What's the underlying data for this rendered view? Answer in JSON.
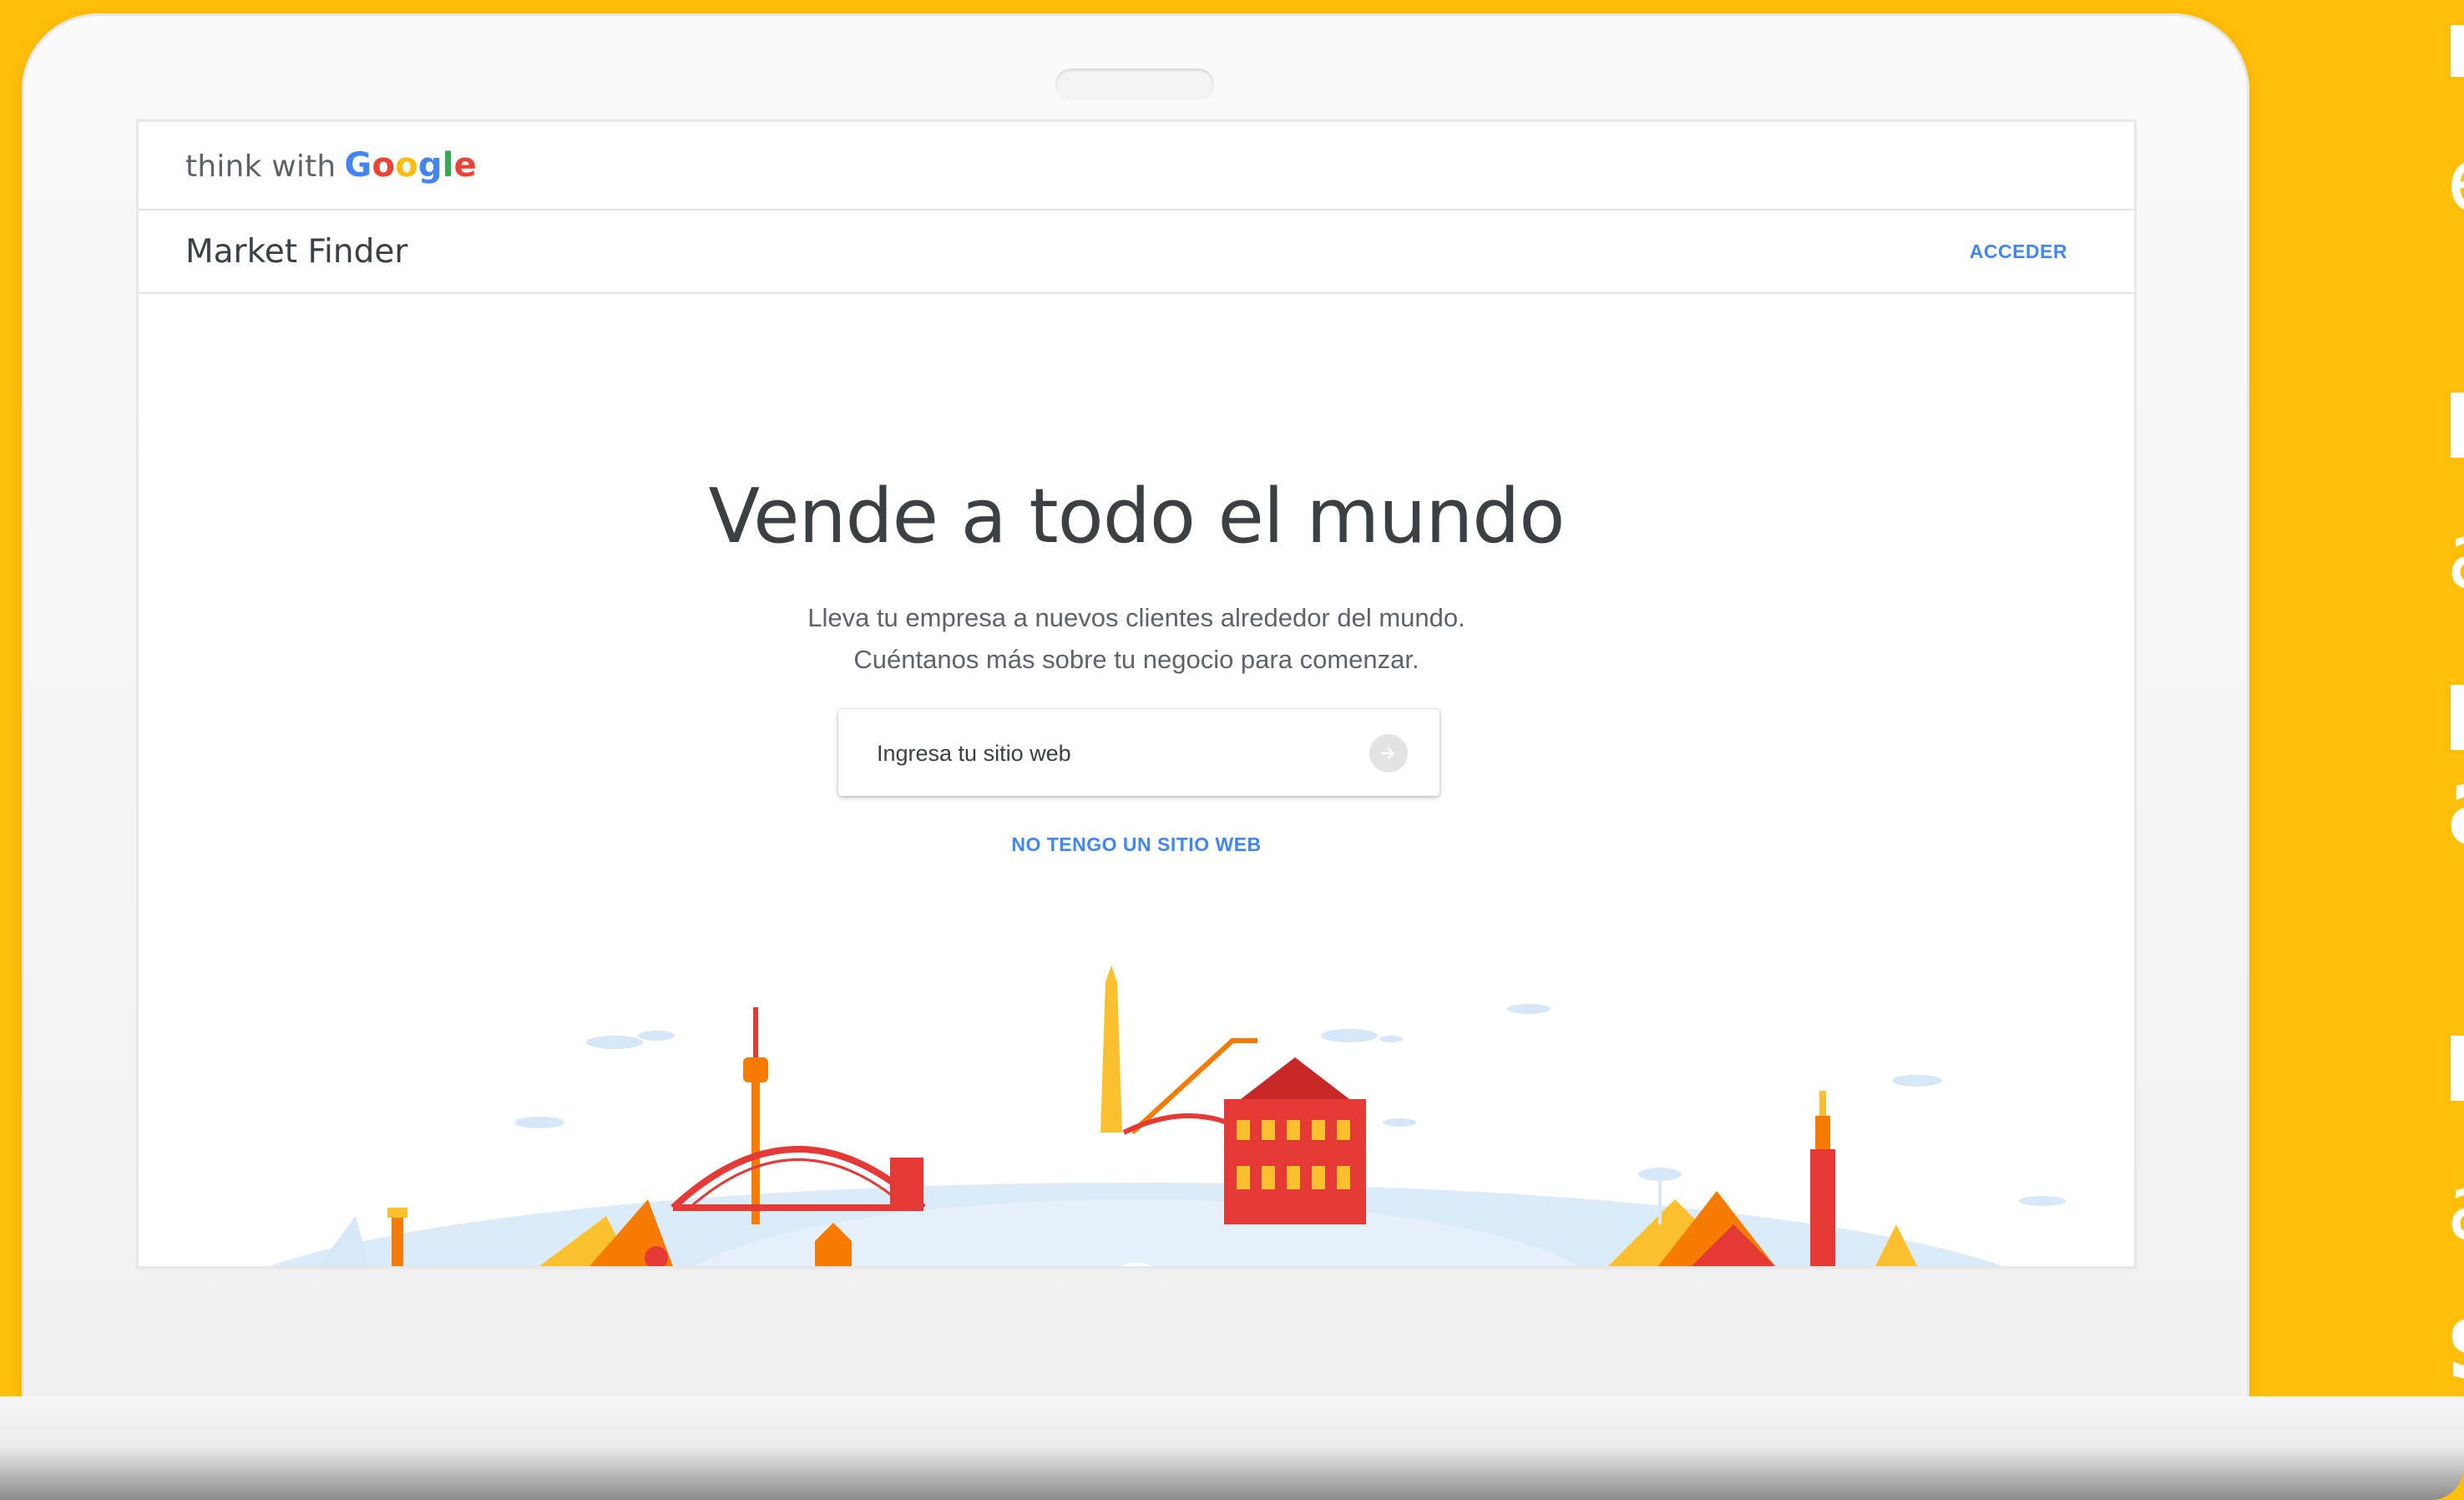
{
  "side_text": [
    "e",
    "a",
    "a",
    "a",
    "s"
  ],
  "header": {
    "logo_prefix": "think with",
    "logo_brand_letters": [
      {
        "ch": "G",
        "color": "#4285F4"
      },
      {
        "ch": "o",
        "color": "#EA4335"
      },
      {
        "ch": "o",
        "color": "#FBBC05"
      },
      {
        "ch": "g",
        "color": "#4285F4"
      },
      {
        "ch": "l",
        "color": "#34A853"
      },
      {
        "ch": "e",
        "color": "#EA4335"
      }
    ]
  },
  "appbar": {
    "title": "Market Finder",
    "signin_label": "ACCEDER"
  },
  "hero": {
    "title": "Vende a todo el mundo",
    "subtitle_lines": [
      "Lleva tu empresa a nuevos clientes alrededor del mundo.",
      "Cuéntanos más sobre tu negocio para comenzar."
    ],
    "website_input": {
      "placeholder": "Ingresa tu sitio web",
      "value": ""
    },
    "submit_icon": "arrow-right-icon",
    "no_website_link": "NO TENGO UN SITIO WEB"
  },
  "illustration": {
    "icon": "world-landmarks-illustration",
    "colors": {
      "orange": "#F57C00",
      "red": "#E53935",
      "yellow": "#FBC02D",
      "blue": "#D6E7F7"
    }
  },
  "colors": {
    "background": "#FFBE0A",
    "accent": "#4285F4",
    "text": "#3c4043"
  }
}
